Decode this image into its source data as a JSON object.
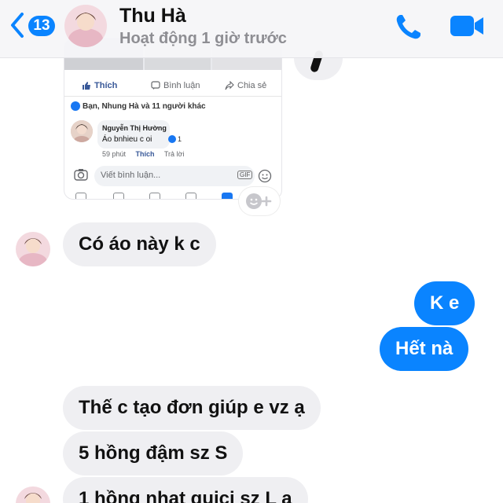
{
  "header": {
    "unread_count": "13",
    "contact_name": "Thu Hà",
    "status": "Hoạt động 1 giờ trước",
    "icons": [
      "back-chevron-icon",
      "phone-icon",
      "video-camera-icon"
    ],
    "accent_color": "#0a84ff"
  },
  "shared_post": {
    "actions": {
      "like": "Thích",
      "comment": "Bình luận",
      "share": "Chia sẻ"
    },
    "reactions_summary": "Bạn, Nhung Hà và 11 người khác",
    "comment": {
      "author": "Nguyễn Thị Hường",
      "text": "Áo bnhieu c oi",
      "like_count": "1",
      "time": "59 phút",
      "like_label": "Thích",
      "reply_label": "Trả lời"
    },
    "input_placeholder": "Viết bình luận...",
    "gif_label": "GIF"
  },
  "messages": [
    {
      "side": "in",
      "text": "Có áo này k c"
    },
    {
      "side": "out",
      "text": "K e"
    },
    {
      "side": "out",
      "text": "Hết nà"
    },
    {
      "side": "in",
      "text": "Thế c tạo đơn giúp e vz ạ"
    },
    {
      "side": "in",
      "text": "5 hồng đậm sz S"
    },
    {
      "side": "in",
      "text": "1 hồng nhạt guici sz L ạ"
    }
  ]
}
